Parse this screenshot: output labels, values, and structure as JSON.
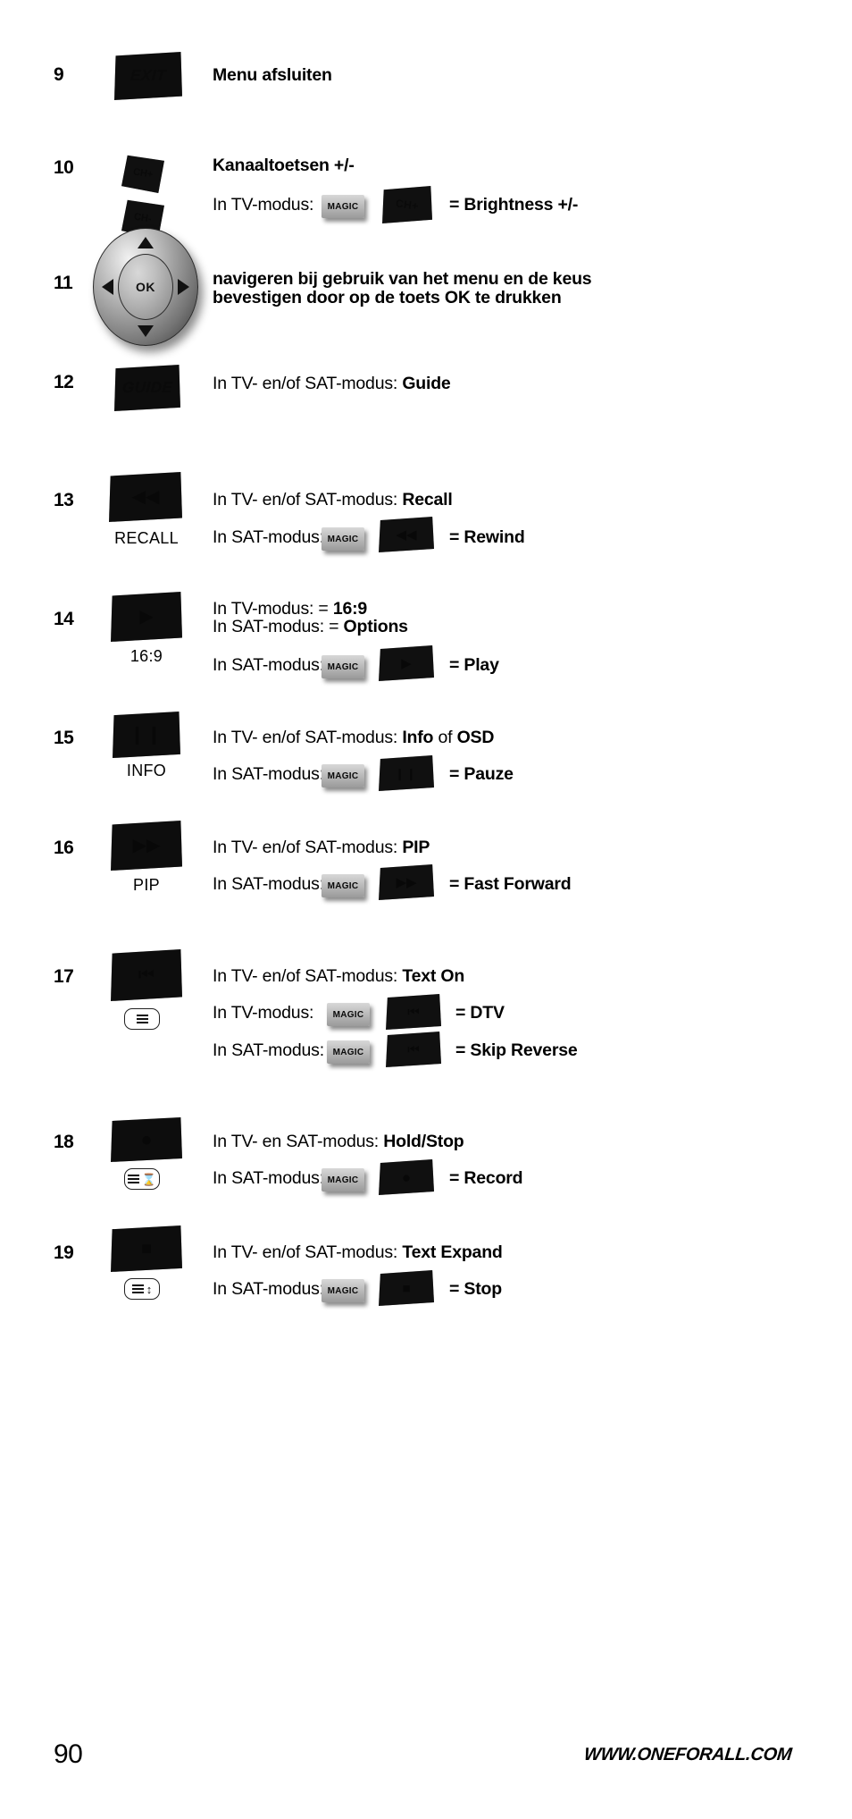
{
  "page": {
    "number": "90",
    "website": "WWW.ONEFORALL.COM"
  },
  "rows": [
    {
      "number": "9",
      "key_label": "EXIT",
      "key_icon": "exit-key",
      "description": "Menu afsluiten",
      "caption": ""
    },
    {
      "number": "10",
      "key_label_plus": "CH+",
      "key_label_minus": "CH-",
      "description": "Kanaaltoetsen +/-",
      "combo": {
        "mode": "In TV-modus:",
        "magic": "MAGIC",
        "key_label": "CH+",
        "result": "= Brightness +/-"
      }
    },
    {
      "number": "11",
      "key_icon": "navigation-wheel",
      "ok_label": "OK",
      "description_line1": "navigeren bij gebruik van het menu en de keus",
      "description_line2": "bevestigen door op de toets OK te drukken"
    },
    {
      "number": "12",
      "key_label": "GUIDE",
      "description_prefix": "In TV- en/of SAT-modus: ",
      "description_bold": "Guide"
    },
    {
      "number": "13",
      "key_icon": "rewind-key",
      "caption": "RECALL",
      "description_prefix": "In TV- en/of SAT-modus: ",
      "description_bold": "Recall",
      "combo": {
        "mode": "In SAT-modus:",
        "magic": "MAGIC",
        "result": "= Rewind"
      }
    },
    {
      "number": "14",
      "key_icon": "play-key",
      "caption": "16:9",
      "line1_prefix": "In TV-modus: = ",
      "line1_bold": "16:9",
      "line2_prefix": "In SAT-modus: = ",
      "line2_bold": "Options",
      "combo": {
        "mode": "In SAT-modus:",
        "magic": "MAGIC",
        "result": "= Play"
      }
    },
    {
      "number": "15",
      "key_icon": "pause-key",
      "caption": "INFO",
      "description_prefix": "In TV- en/of SAT-modus: ",
      "description_bold": "Info",
      "description_mid": " of ",
      "description_bold2": "OSD",
      "combo": {
        "mode": "In SAT-modus:",
        "magic": "MAGIC",
        "result": "= Pauze"
      }
    },
    {
      "number": "16",
      "key_icon": "fast-forward-key",
      "caption": "PIP",
      "description_prefix": "In TV- en/of SAT-modus: ",
      "description_bold": "PIP",
      "combo": {
        "mode": "In SAT-modus:",
        "magic": "MAGIC",
        "result": "= Fast Forward"
      }
    },
    {
      "number": "17",
      "key_icon": "skip-reverse-key",
      "sub_icon": "teletext-lines-icon",
      "description_prefix": "In TV- en/of SAT-modus: ",
      "description_bold": "Text On",
      "combo1": {
        "mode": "In TV-modus:",
        "magic": "MAGIC",
        "result": "= DTV"
      },
      "combo2": {
        "mode": "In SAT-modus:",
        "magic": "MAGIC",
        "result": "= Skip Reverse"
      }
    },
    {
      "number": "18",
      "key_icon": "record-key",
      "sub_icon": "teletext-hold-icon",
      "description_prefix": "In TV- en SAT-modus: ",
      "description_bold": "Hold/Stop",
      "combo": {
        "mode": "In SAT-modus:",
        "magic": "MAGIC",
        "result": "= Record"
      }
    },
    {
      "number": "19",
      "key_icon": "stop-key",
      "sub_icon": "teletext-expand-icon",
      "description_prefix": "In TV- en/of SAT-modus: ",
      "description_bold": "Text Expand",
      "combo": {
        "mode": "In SAT-modus:",
        "magic": "MAGIC",
        "result": "= Stop"
      }
    }
  ]
}
